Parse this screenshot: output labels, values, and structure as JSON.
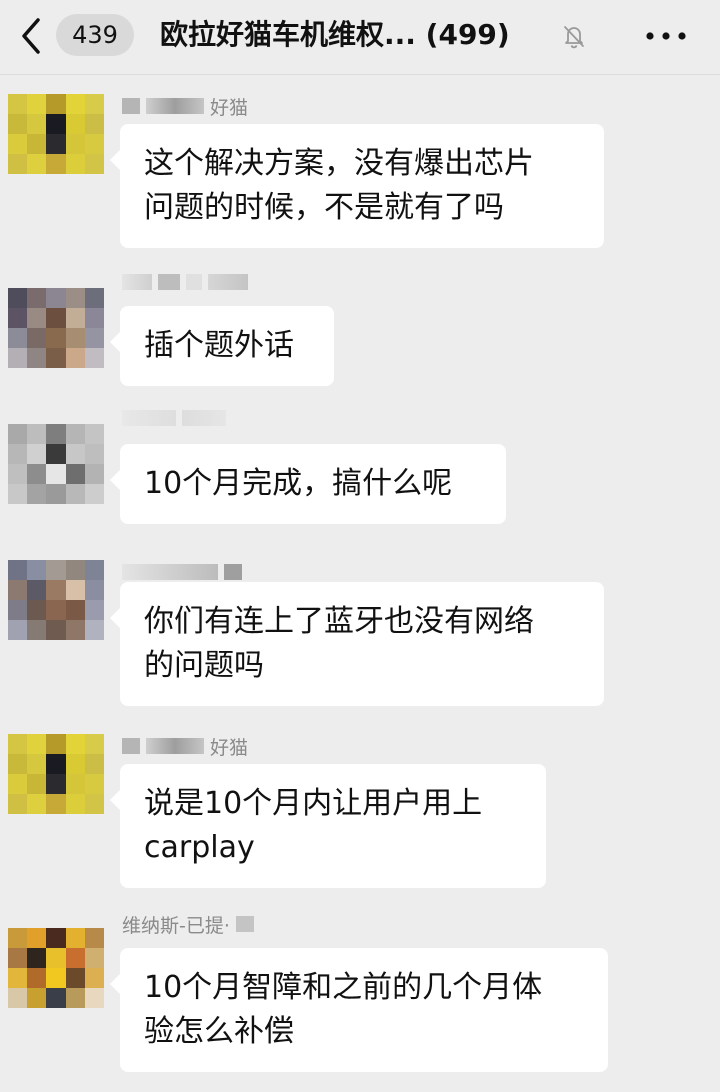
{
  "header": {
    "back_icon": "chevron-left-icon",
    "unread_count": "439",
    "title": "欧拉好猫车机维权... (499)",
    "mute_icon": "bell-off-icon",
    "more_icon": "more-dots-icon"
  },
  "messages": [
    {
      "sender": "好猫",
      "text": "这个解决方案，没有爆出芯片\n问题的时候，不是就有了吗"
    },
    {
      "sender": "",
      "text": "插个题外话"
    },
    {
      "sender": "",
      "text": "10个月完成，搞什么呢"
    },
    {
      "sender": "",
      "text": "你们有连上了蓝牙也没有网络\n的问题吗"
    },
    {
      "sender": "好猫",
      "text": "说是10个月内让用户用上\ncarplay"
    },
    {
      "sender": "维纳斯-已提·",
      "text": "10个月智障和之前的几个月体\n验怎么补偿"
    }
  ]
}
